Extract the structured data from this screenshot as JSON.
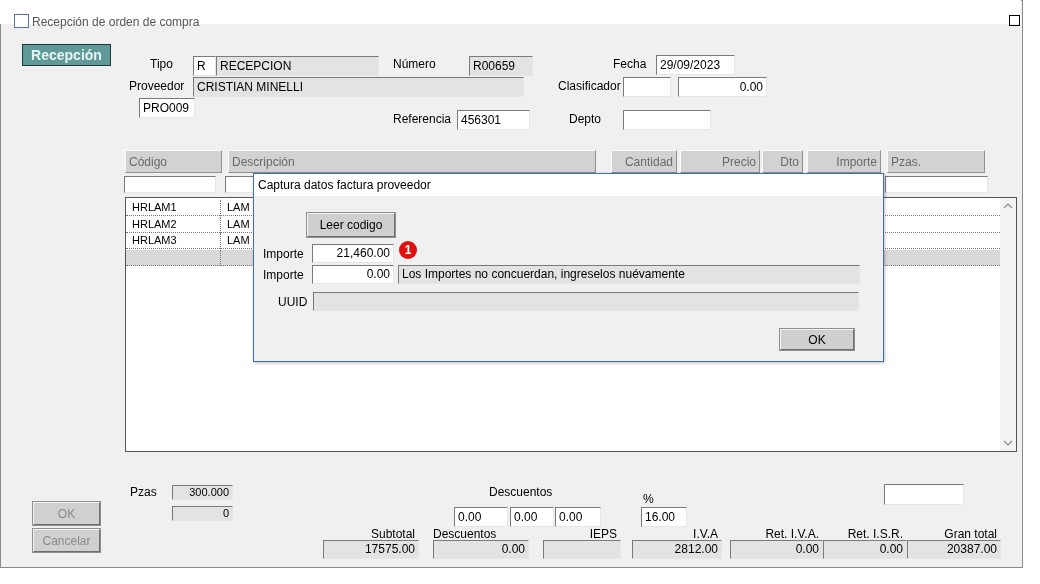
{
  "window": {
    "title": "Recepción de orden de compra"
  },
  "mode_button": {
    "label": "Recepción"
  },
  "header": {
    "labels": {
      "tipo": "Tipo",
      "numero": "Número",
      "fecha": "Fecha",
      "proveedor": "Proveedor",
      "clasificador": "Clasificador",
      "referencia": "Referencia",
      "depto": "Depto"
    },
    "fields": {
      "tipo_code": {
        "value": "R",
        "readonly": false
      },
      "tipo_name": {
        "value": "RECEPCION",
        "readonly": true
      },
      "numero": {
        "value": "R00659",
        "readonly": true
      },
      "fecha": {
        "value": "29/09/2023",
        "readonly": false
      },
      "proveedor_name": {
        "value": "CRISTIAN MINELLI",
        "readonly": true
      },
      "proveedor_code": {
        "value": "PRO009",
        "readonly": false
      },
      "clasificador_code": {
        "readonly": false
      },
      "clasificador_amount": {
        "value": "0.00",
        "readonly": false
      },
      "referencia": {
        "value": "456301",
        "readonly": false
      },
      "depto": {
        "readonly": false
      }
    }
  },
  "table": {
    "columns": [
      {
        "label": "Código"
      },
      {
        "label": "Descripción"
      },
      {
        "label": "Cantidad"
      },
      {
        "label": "Precio"
      },
      {
        "label": "Dto"
      },
      {
        "label": "Importe"
      },
      {
        "label": "Pzas."
      }
    ],
    "rows": [
      {
        "code": "HRLAM1",
        "description": "LAM",
        "selected": false
      },
      {
        "code": "HRLAM2",
        "description": "LAM",
        "selected": false
      },
      {
        "code": "HRLAM3",
        "description": "LAM",
        "selected": false
      },
      {
        "selected": true
      }
    ]
  },
  "dialog": {
    "title": "Captura datos factura proveedor",
    "read_button": "Leer codigo",
    "fields": [
      {
        "kind": "amount",
        "label": "Importe",
        "value": "21,460.00",
        "marker": "1"
      },
      {
        "kind": "amount",
        "label": "Importe",
        "value": "0.00",
        "message": "Los Importes no concuerdan, ingreselos nuévamente"
      },
      {
        "kind": "text",
        "label": "UUID"
      }
    ],
    "ok_button": "OK"
  },
  "pieces": {
    "label": "Pzas",
    "values": [
      "300.000",
      "0"
    ]
  },
  "buttons": [
    {
      "label": "OK",
      "disabled": true
    },
    {
      "label": "Cancelar",
      "disabled": true
    }
  ],
  "discounts": {
    "label": "Descuentos",
    "values": [
      "0.00",
      "0.00",
      "0.00"
    ]
  },
  "tax_rate": {
    "label": "%",
    "value": "16.00"
  },
  "totals": [
    {
      "label": "Subtotal",
      "value": "17575.00"
    },
    {
      "label": "Descuentos",
      "value": "0.00"
    },
    {
      "label": "IEPS"
    },
    {
      "label": "I.V.A",
      "value": "2812.00"
    },
    {
      "label": "Ret. I.V.A.",
      "value": "0.00"
    },
    {
      "label": "Ret. I.S.R.",
      "value": "0.00"
    },
    {
      "label": "Gran total",
      "value": "20387.00"
    }
  ]
}
